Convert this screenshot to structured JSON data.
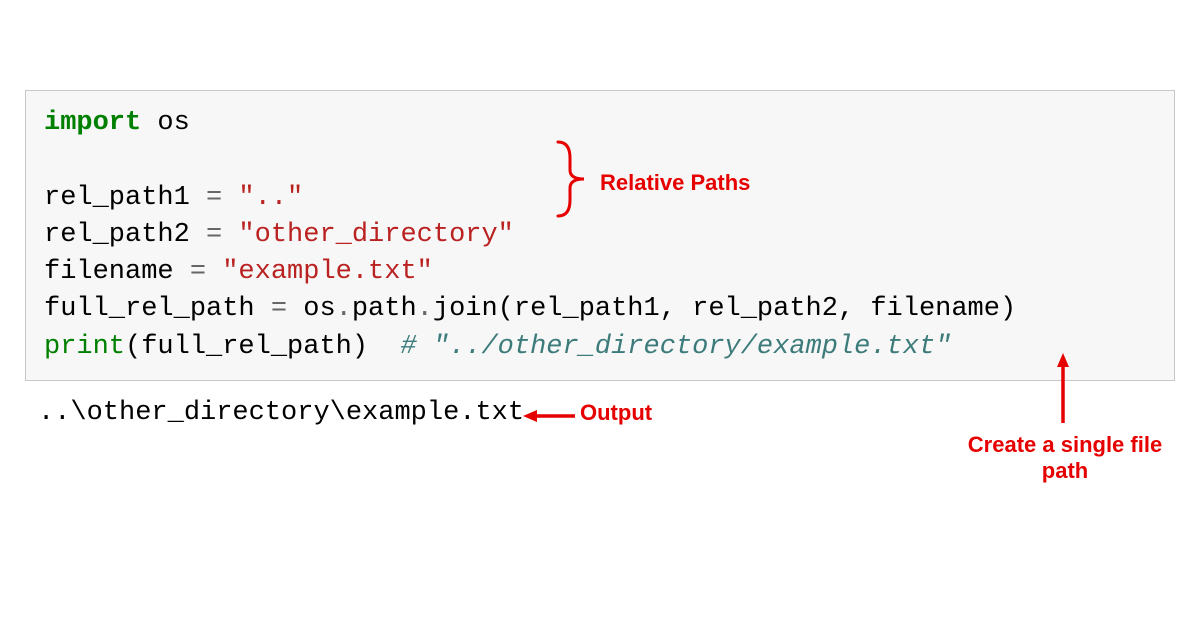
{
  "code": {
    "import_kw": "import",
    "import_mod": " os",
    "line3_var": "rel_path1 ",
    "line3_op": "=",
    "line3_str": " \"..\"",
    "line4_var": "rel_path2 ",
    "line4_op": "=",
    "line4_str": " \"other_directory\"",
    "line5_var": "filename ",
    "line5_op": "=",
    "line5_str": " \"example.txt\"",
    "line6_var": "full_rel_path ",
    "line6_op": "=",
    "line6_rest": " os",
    "line6_dot1": ".",
    "line6_path": "path",
    "line6_dot2": ".",
    "line6_join": "join(rel_path1, rel_path2, filename)",
    "line7_print": "print",
    "line7_args": "(full_rel_path)  ",
    "line7_comment": "# \"../other_directory/example.txt\""
  },
  "output": "..\\other_directory\\example.txt",
  "annotations": {
    "relpaths": "Relative Paths",
    "output_label": "Output",
    "singlefile": "Create a single file path"
  },
  "colors": {
    "annotation_red": "#e60000",
    "code_bg": "#f7f7f7",
    "keyword_green": "#008000",
    "string_red": "#BA2121",
    "comment_teal": "#3D7B7B"
  }
}
